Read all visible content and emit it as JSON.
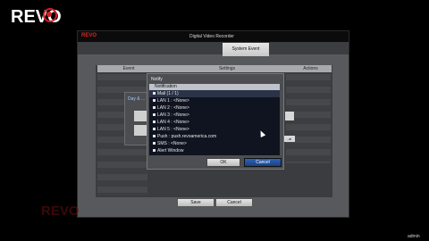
{
  "logo": {
    "text": "REVO",
    "tagline": ""
  },
  "window": {
    "brand": "REVO",
    "title": "Digital Video Recorder",
    "active_tab": "System Event"
  },
  "columns": [
    "Event",
    "Settings",
    "Actions"
  ],
  "background": {
    "dialog_label": "Day & ...",
    "right_button": "...al"
  },
  "footer": {
    "save_label": "Save",
    "cancel_label": "Cancel"
  },
  "notify": {
    "title": "Notify",
    "header": "Notification",
    "items": [
      "Mail (1 / 1)",
      "LAN 1 : <None>",
      "LAN 2 : <None>",
      "LAN 3 : <None>",
      "LAN 4 : <None>",
      "LAN 5 : <None>",
      "Push : push.revoamerica.com",
      "SMS : <None>",
      "Alert Window"
    ],
    "ok_label": "OK",
    "cancel_label": "Cancel"
  },
  "watermark": "REVO",
  "user": "admin"
}
